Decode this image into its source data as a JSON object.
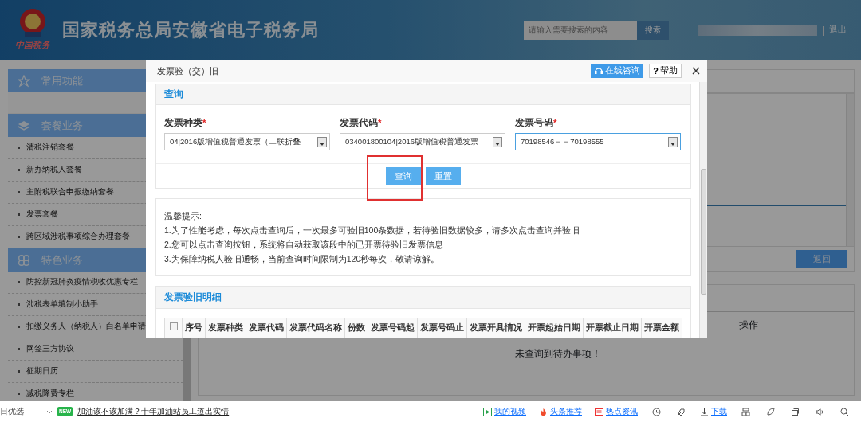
{
  "header": {
    "title": "国家税务总局安徽省电子税务局",
    "logo_caption": "中国税务",
    "search": {
      "placeholder": "请输入需要搜索的内容",
      "button": "搜索"
    },
    "separator": "|",
    "logout": "退出"
  },
  "sidebar": {
    "sections": [
      {
        "title": "常用功能"
      },
      {
        "title": "套餐业务",
        "items": [
          "清税注销套餐",
          "新办纳税人套餐",
          "主附税联合申报缴纳套餐",
          "发票套餐",
          "跨区域涉税事项综合办理套餐"
        ]
      },
      {
        "title": "特色业务",
        "items": [
          "防控新冠肺炎疫情税收优惠专栏",
          "涉税表单填制小助手",
          "扣缴义务人（纳税人）白名单申请",
          "网签三方协议",
          "征期日历",
          "减税降费专栏"
        ]
      }
    ]
  },
  "main": {
    "return_button": "返回",
    "table_column": "操作",
    "empty_message": "未查询到待办事项！"
  },
  "modal": {
    "title": "发票验（交）旧",
    "consult_button": "在线咨询",
    "help_button": {
      "icon": "?",
      "label": "帮助"
    },
    "query": {
      "title": "查询",
      "fields": [
        {
          "label": "发票种类",
          "required_mark": "*",
          "value": "04|2016版增值税普通发票（二联折叠",
          "focused": false
        },
        {
          "label": "发票代码",
          "required_mark": "*",
          "value": "034001800104|2016版增值税普通发票",
          "focused": false
        },
        {
          "label": "发票号码",
          "required_mark": "*",
          "value": "70198546－－70198555",
          "focused": true
        }
      ],
      "buttons": [
        "查询",
        "重置"
      ],
      "annotations": [
        {
          "kind": "highlight-box"
        }
      ]
    },
    "tips": {
      "title": "温馨提示:",
      "lines": [
        "1.为了性能考虑，每次点击查询后，一次最多可验旧100条数据，若待验旧数据较多，请多次点击查询并验旧",
        "2.您可以点击查询按钮，系统将自动获取该段中的已开票待验旧发票信息",
        "3.为保障纳税人验旧通畅，当前查询时间限制为120秒每次，敬请谅解。"
      ]
    },
    "details": {
      "title": "发票验旧明细",
      "select_all_checked": false,
      "columns": [
        "序号",
        "发票种类",
        "发票代码",
        "发票代码名称",
        "份数",
        "发票号码起",
        "发票号码止",
        "发票开具情况",
        "开票起始日期",
        "开票截止日期",
        "开票金额"
      ]
    }
  },
  "status_bar": {
    "left_text": "日优选",
    "badge": "NEW",
    "headline": "加油该不该加满？十年加油站员工道出实情",
    "items": [
      {
        "kind": "video",
        "label": "我的视频"
      },
      {
        "kind": "fire",
        "label": "头条推荐"
      },
      {
        "kind": "news",
        "label": "热点资讯"
      },
      {
        "kind": "download",
        "label": "下载"
      }
    ]
  }
}
